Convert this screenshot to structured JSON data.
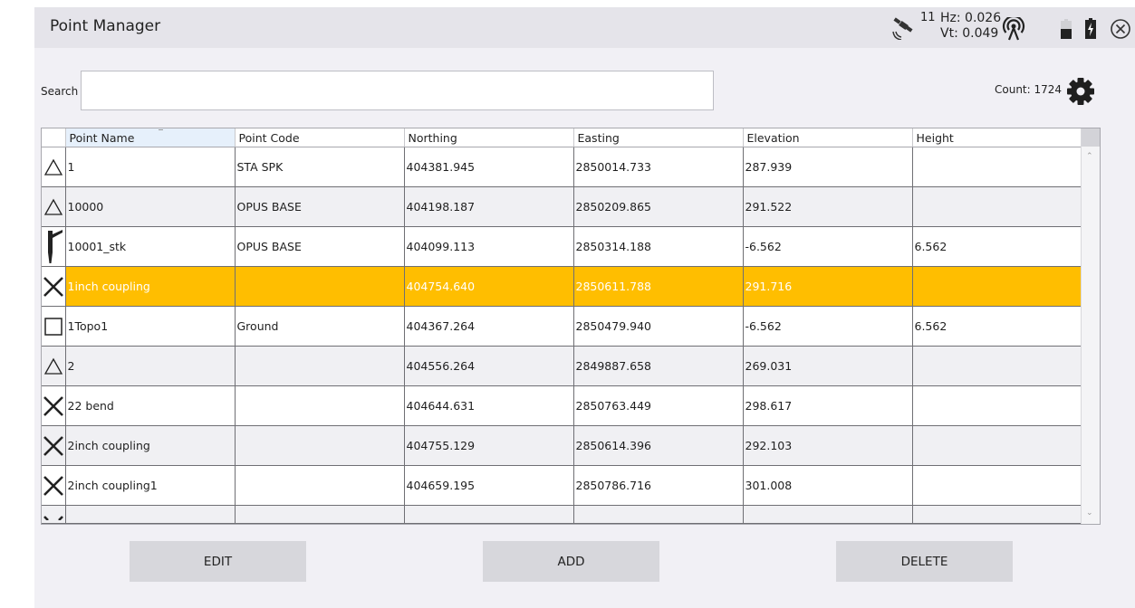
{
  "header": {
    "title": "Point Manager",
    "satellites": "11",
    "hz": "Hz: 0.026",
    "vt": "Vt: 0.049"
  },
  "search": {
    "label": "Search",
    "value": "",
    "count": "Count: 1724"
  },
  "table": {
    "columns": [
      "Point Name",
      "Point Code",
      "Northing",
      "Easting",
      "Elevation",
      "Height"
    ],
    "rows": [
      {
        "icon": "triangle-icon",
        "name": "1",
        "code": "STA SPK",
        "northing": "404381.945",
        "easting": "2850014.733",
        "elevation": "287.939",
        "height": ""
      },
      {
        "icon": "triangle-icon",
        "name": "10000",
        "code": "OPUS BASE",
        "northing": "404198.187",
        "easting": "2850209.865",
        "elevation": "291.522",
        "height": ""
      },
      {
        "icon": "gps-pole-icon",
        "name": "10001_stk",
        "code": "OPUS BASE",
        "northing": "404099.113",
        "easting": "2850314.188",
        "elevation": "-6.562",
        "height": "6.562"
      },
      {
        "icon": "x-mark-icon",
        "name": "1inch coupling",
        "code": "",
        "northing": "404754.640",
        "easting": "2850611.788",
        "elevation": "291.716",
        "height": ""
      },
      {
        "icon": "square-icon",
        "name": "1Topo1",
        "code": "Ground",
        "northing": "404367.264",
        "easting": "2850479.940",
        "elevation": "-6.562",
        "height": "6.562"
      },
      {
        "icon": "triangle-icon",
        "name": "2",
        "code": "",
        "northing": "404556.264",
        "easting": "2849887.658",
        "elevation": "269.031",
        "height": ""
      },
      {
        "icon": "x-mark-icon",
        "name": "22 bend",
        "code": "",
        "northing": "404644.631",
        "easting": "2850763.449",
        "elevation": "298.617",
        "height": ""
      },
      {
        "icon": "x-mark-icon",
        "name": "2inch coupling",
        "code": "",
        "northing": "404755.129",
        "easting": "2850614.396",
        "elevation": "292.103",
        "height": ""
      },
      {
        "icon": "x-mark-icon",
        "name": "2inch coupling1",
        "code": "",
        "northing": "404659.195",
        "easting": "2850786.716",
        "elevation": "301.008",
        "height": ""
      }
    ],
    "selected_row": 3
  },
  "buttons": {
    "edit": "EDIT",
    "add": "ADD",
    "delete": "DELETE"
  },
  "colors": {
    "selected_row": "#ffbe00",
    "alt_row": "#f0f0f3",
    "background": "#f1f0f5"
  }
}
